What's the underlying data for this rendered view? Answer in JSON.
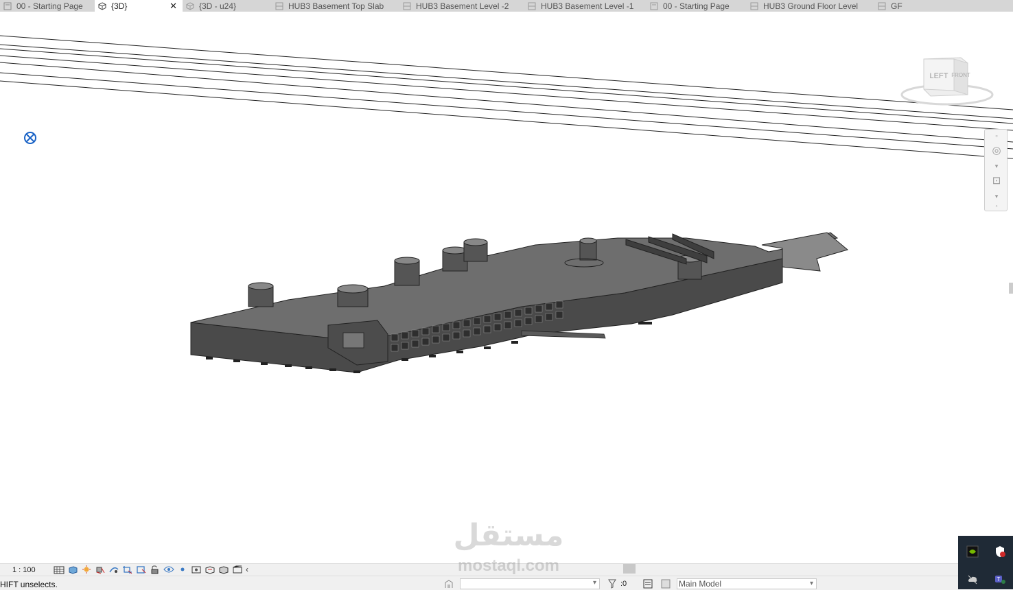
{
  "tabs": [
    {
      "label": "00 - Starting Page",
      "icon": "sheet-icon",
      "active": false
    },
    {
      "label": "{3D}",
      "icon": "3d-view-icon",
      "active": true
    },
    {
      "label": "{3D - u24}",
      "icon": "3d-view-icon",
      "active": false
    },
    {
      "label": "HUB3 Basement Top Slab",
      "icon": "floor-plan-icon",
      "active": false
    },
    {
      "label": "HUB3 Basement Level -2",
      "icon": "floor-plan-icon",
      "active": false
    },
    {
      "label": "HUB3 Basement Level -1",
      "icon": "floor-plan-icon",
      "active": false
    },
    {
      "label": "00 - Starting Page",
      "icon": "sheet-icon",
      "active": false
    },
    {
      "label": "HUB3 Ground Floor Level",
      "icon": "floor-plan-icon",
      "active": false
    },
    {
      "label": "GF",
      "icon": "floor-plan-icon",
      "active": false
    }
  ],
  "tab_close_glyph": "✕",
  "viewcube": {
    "left_face": "LEFT",
    "front_face": "FRONT"
  },
  "view_control_bar": {
    "scale": "1 : 100",
    "icons": [
      "detail-level-icon",
      "visual-style-icon",
      "sun-path-icon",
      "shadows-icon",
      "show-rendering-icon",
      "crop-view-icon",
      "show-crop-region-icon",
      "unlock-3d-view-icon",
      "temporary-hide-icon",
      "reveal-hidden-icon",
      "temporary-view-properties-icon",
      "hide-analytical-model-icon",
      "highlight-displacement-icon",
      "reveal-constraints-icon",
      "collapse-icon"
    ]
  },
  "status": {
    "message": "HIFT unselects.",
    "selection_count": ":0",
    "active_model": "Main Model"
  },
  "watermark": {
    "arabic": "مستقل",
    "latin": "mostaql.com"
  },
  "colors": {
    "tabbar": "#d6d6d6",
    "model_dark": "#4a4a4a",
    "model_mid": "#6e6e6e",
    "model_light": "#9a9a9a",
    "tray": "#1f2a36"
  }
}
